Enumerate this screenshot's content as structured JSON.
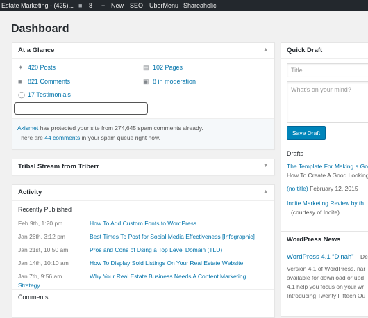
{
  "adminbar": {
    "site_name": "Estate Marketing - (425)...",
    "comments_count": "8",
    "new_label": "New",
    "seo_label": "SEO",
    "ubermenu_label": "UberMenu",
    "shareaholic_label": "Shareaholic"
  },
  "page_title": "Dashboard",
  "at_a_glance": {
    "title": "At a Glance",
    "posts": "420 Posts",
    "pages": "102 Pages",
    "comments": "821 Comments",
    "moderation": "8 in moderation",
    "testimonials": "17 Testimonials",
    "akismet_link": "Akismet",
    "akismet_text": " has protected your site from 274,645 spam comments already.",
    "spam_prefix": "There are ",
    "spam_link": "44 comments",
    "spam_suffix": " in your spam queue right now."
  },
  "tribal": {
    "title": "Tribal Stream from Triberr"
  },
  "activity": {
    "title": "Activity",
    "recently_published": "Recently Published",
    "items": [
      {
        "date": "Feb 9th, 1:20 pm",
        "title": "How To Add Custom Fonts to WordPress"
      },
      {
        "date": "Jan 26th, 3:12 pm",
        "title": "Best Times To Post for Social Media Effectiveness [Infographic]"
      },
      {
        "date": "Jan 21st, 10:50 am",
        "title": "Pros and Cons of Using a Top Level Domain (TLD)"
      },
      {
        "date": "Jan 14th, 10:10 am",
        "title": "How To Display Sold Listings On Your Real Estate Website"
      },
      {
        "date": "Jan 7th, 9:56 am",
        "title": "Why Your Real Estate Business Needs A Content Marketing",
        "title_cont": "Strategy"
      }
    ],
    "comments_heading": "Comments"
  },
  "quick_draft": {
    "title": "Quick Draft",
    "title_placeholder": "Title",
    "content_placeholder": "What's on your mind?",
    "save_label": "Save Draft",
    "drafts_heading": "Drafts",
    "drafts": [
      {
        "title": "The Template For Making a Go",
        "excerpt": "How To Create A Good Looking"
      },
      {
        "title": "(no title)",
        "date": " February 12, 2015"
      },
      {
        "title": "Incite Marketing Review by th",
        "excerpt": "(courtesy of Incite)"
      }
    ]
  },
  "wp_news": {
    "title": "WordPress News",
    "headline": "WordPress 4.1 “Dinah”",
    "headline_date": "De",
    "lines": [
      "Version 4.1 of WordPress, nar",
      "available for download or upd",
      "4.1 help you focus on your wr",
      "Introducing Twenty Fifteen Ou"
    ]
  }
}
